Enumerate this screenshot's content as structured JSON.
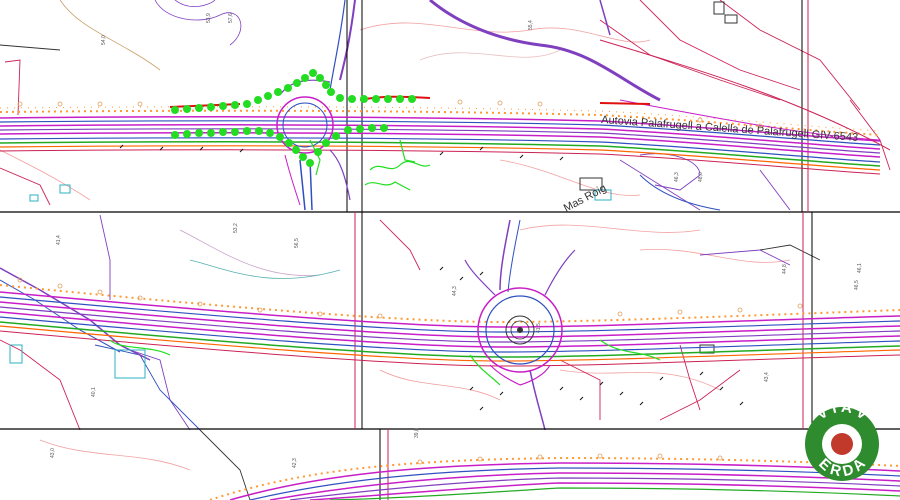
{
  "map": {
    "road_label": "Autovia Palafrugell a Calella de Palafrugell GIV-6543",
    "place_label": "Mas Roig",
    "logo_letters": [
      "V",
      "I",
      "A",
      "V",
      "E",
      "R",
      "D",
      "A"
    ],
    "elevation_labels": [
      "54,0",
      "53,9",
      "57,6",
      "55,4",
      "46,3",
      "48,0",
      "53,2",
      "56,5",
      "41,4",
      "44,3",
      "40,1",
      "44,8",
      "43,4",
      "41,5",
      "46,1",
      "46,5",
      "43,0",
      "42,3",
      "39,8"
    ],
    "colors": {
      "road_main": "#c81ec8",
      "road_secondary": "#7f3fbf",
      "vegetation": "#22dd22",
      "contour": "#f2a0a0",
      "cadastral": "#cc2255",
      "sheet_border": "#000000",
      "logo_green": "#2e8b2e",
      "logo_red": "#c0392b"
    }
  }
}
